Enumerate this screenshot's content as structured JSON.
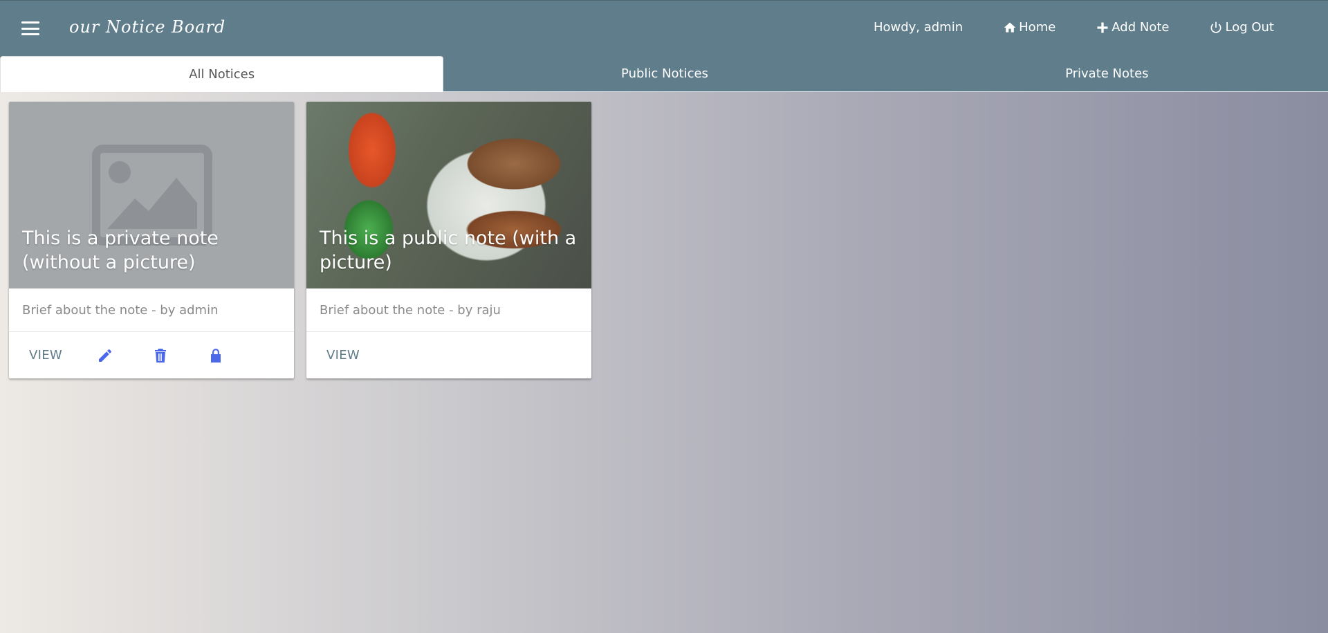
{
  "app": {
    "brand": "our Notice Board",
    "greeting": "Howdy, admin"
  },
  "nav": {
    "home": "Home",
    "add_note": "Add Note",
    "logout": "Log Out"
  },
  "tabs": [
    {
      "label": "All Notices",
      "active": true
    },
    {
      "label": "Public Notices",
      "active": false
    },
    {
      "label": "Private Notes",
      "active": false
    }
  ],
  "notes": [
    {
      "title": "This is a private note (without a picture)",
      "brief": "Brief about the note - by admin",
      "view_label": "VIEW",
      "has_picture": false,
      "actions": [
        "edit-icon",
        "trash-icon",
        "lock-icon"
      ]
    },
    {
      "title": "This is a public note (with a picture)",
      "brief": "Brief about the note - by raju",
      "view_label": "VIEW",
      "has_picture": true,
      "actions": []
    }
  ],
  "colors": {
    "header": "#607d8b",
    "action_icon": "#4c67e8",
    "view_text": "#5f7b89"
  }
}
